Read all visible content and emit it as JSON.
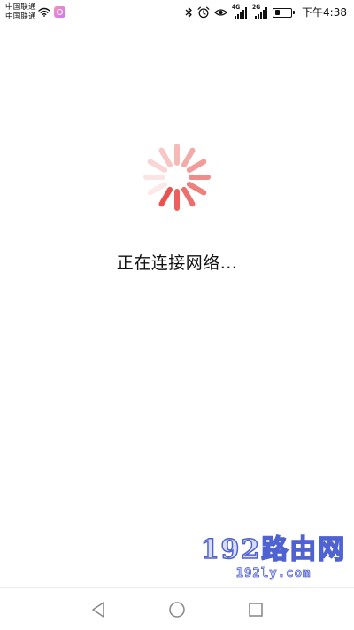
{
  "status_bar": {
    "carrier_1": "中国联通",
    "carrier_2": "中国联通",
    "network_1": "4G",
    "network_2": "2G",
    "battery_level": 0.35,
    "clock": "下午4:38"
  },
  "loading": {
    "message": "正在连接网络...",
    "spinner_color": "#e8534f"
  },
  "watermark": {
    "title": "192路由网",
    "subtitle": "192ly.com"
  },
  "icons": {
    "wifi": "wifi-icon",
    "app_badge": "app-badge-icon",
    "bluetooth": "bluetooth-icon",
    "alarm": "alarm-icon",
    "eye": "eye-comfort-icon",
    "signal": "signal-icon",
    "battery": "battery-icon",
    "spinner": "spinner-icon",
    "back": "back-icon",
    "home": "home-icon",
    "recent": "recent-apps-icon"
  }
}
